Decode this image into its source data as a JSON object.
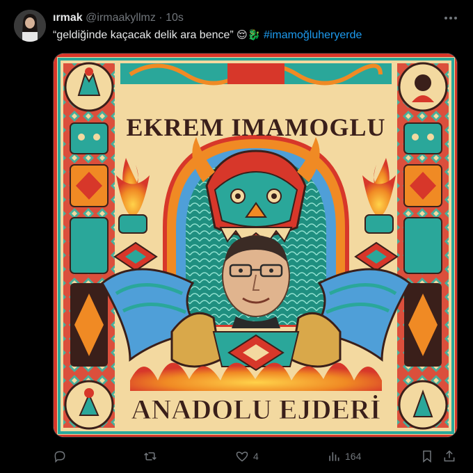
{
  "tweet": {
    "display_name": "ırmak",
    "handle": "@irmaakyllmz",
    "separator": "·",
    "time": "10s",
    "text_quote": "“geldiğinde kaçacak delik ara bence”",
    "emojis": "😌🐉",
    "hashtag": "#imamoğluheryerde"
  },
  "media": {
    "poster_title": "EKREM IMAMOGLU",
    "poster_subtitle": "ANADOLU EJDERİ",
    "colors": {
      "background": "#f3d9a0",
      "red": "#d7372a",
      "teal": "#2aa79a",
      "orange": "#f08a24",
      "dark": "#3a1f1a",
      "blue": "#4f9fd8"
    }
  },
  "actions": {
    "reply_icon": "reply-icon",
    "retweet_icon": "retweet-icon",
    "like_icon": "heart-icon",
    "like_count": "4",
    "views_icon": "views-icon",
    "views_count": "164",
    "bookmark_icon": "bookmark-icon",
    "share_icon": "share-icon"
  }
}
